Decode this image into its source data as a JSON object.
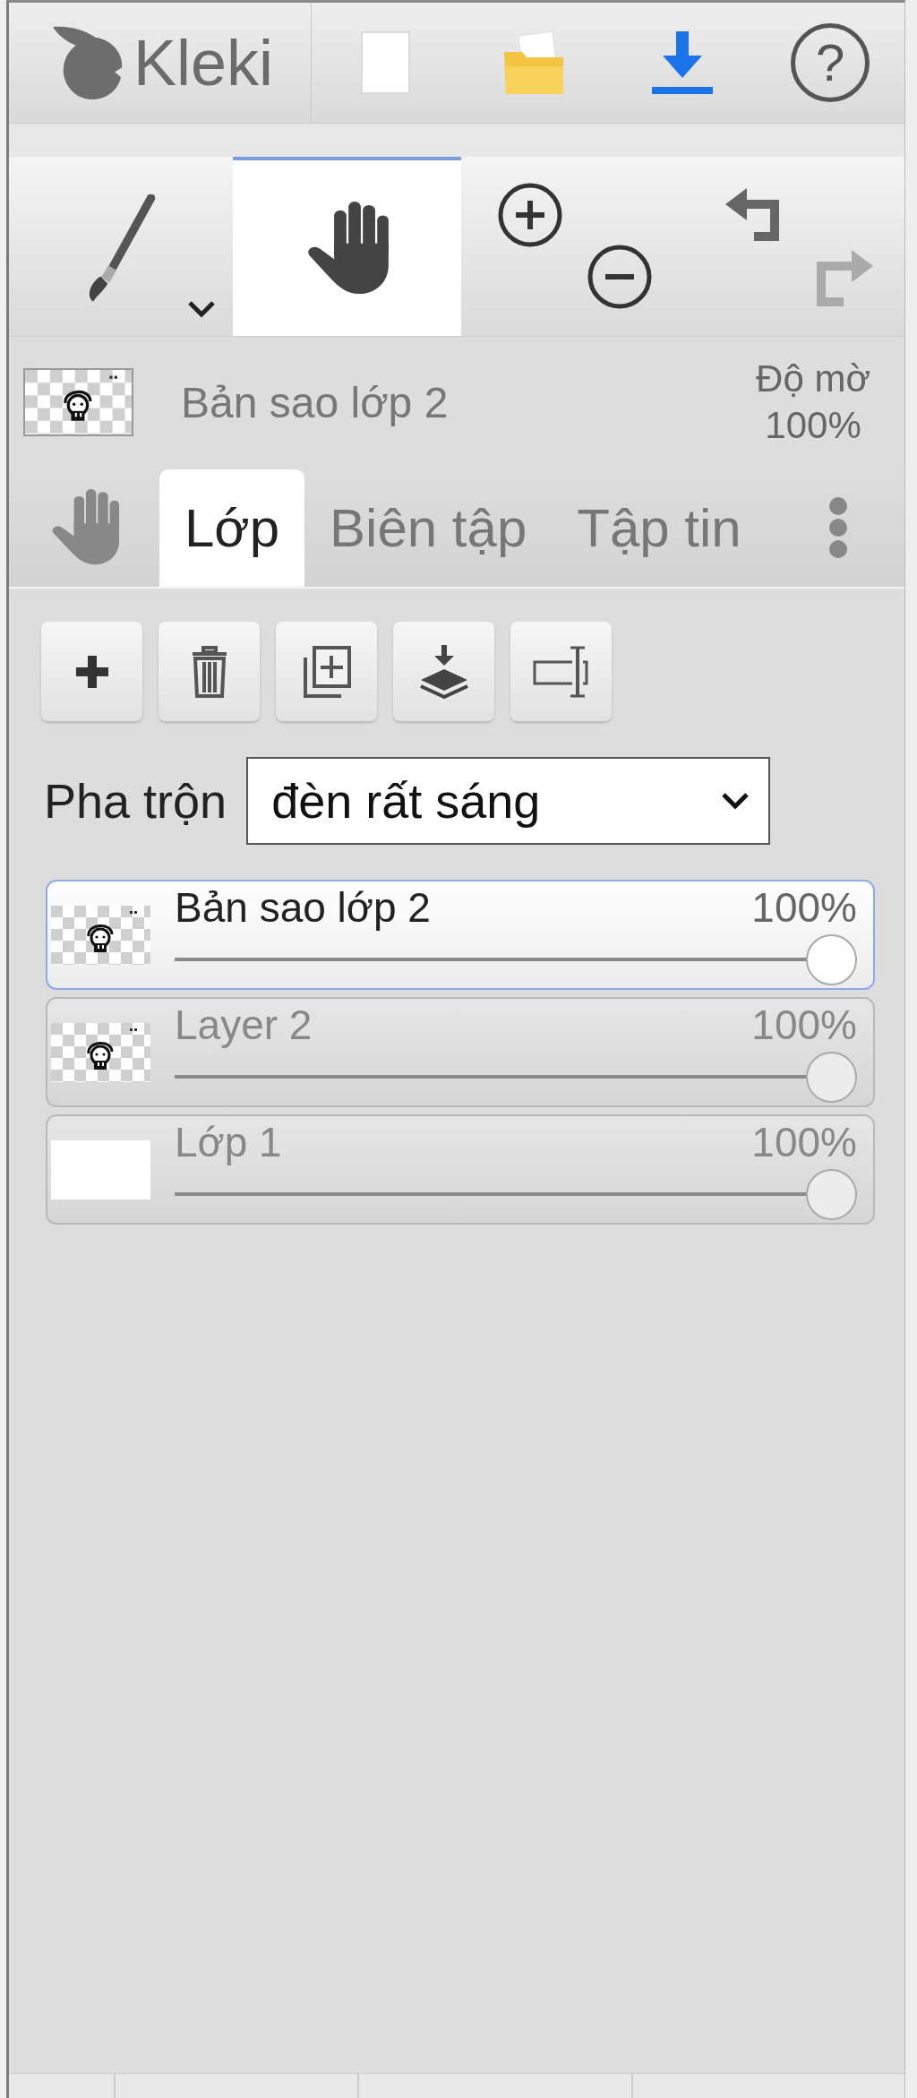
{
  "top_bar": {
    "logo_text": "Kleki",
    "actions": [
      {
        "kind": "new"
      },
      {
        "kind": "open"
      },
      {
        "kind": "download"
      },
      {
        "kind": "help",
        "label": "?"
      }
    ]
  },
  "tools": [
    {
      "kind": "brush",
      "selected": false
    },
    {
      "kind": "hand",
      "selected": true
    }
  ],
  "history": {
    "undo_disabled": false,
    "redo_disabled": true
  },
  "current_layer": {
    "thumbnail": {
      "kind": "sketch"
    },
    "name": "Bản sao lớp 2",
    "opacity_label": "Độ mờ",
    "opacity_value": "100%"
  },
  "tabs": [
    {
      "label": "Lớp",
      "selected": true
    },
    {
      "label": "Biên tập",
      "selected": false
    },
    {
      "label": "Tập tin",
      "selected": false
    }
  ],
  "layer_actions": [
    {
      "kind": "add"
    },
    {
      "kind": "delete"
    },
    {
      "kind": "duplicate"
    },
    {
      "kind": "merge"
    },
    {
      "kind": "rename"
    }
  ],
  "blend": {
    "label": "Pha trộn",
    "value": "đèn rất sáng"
  },
  "layers": [
    {
      "kind": "sketch",
      "name": "Bản sao lớp 2",
      "opacity": "100%",
      "level": 1,
      "selected": true
    },
    {
      "kind": "sketch",
      "name": "Layer 2",
      "opacity": "100%",
      "level": 1,
      "selected": false
    },
    {
      "kind": "blank",
      "name": "Lớp 1",
      "opacity": "100%",
      "level": 1,
      "selected": false
    }
  ]
}
